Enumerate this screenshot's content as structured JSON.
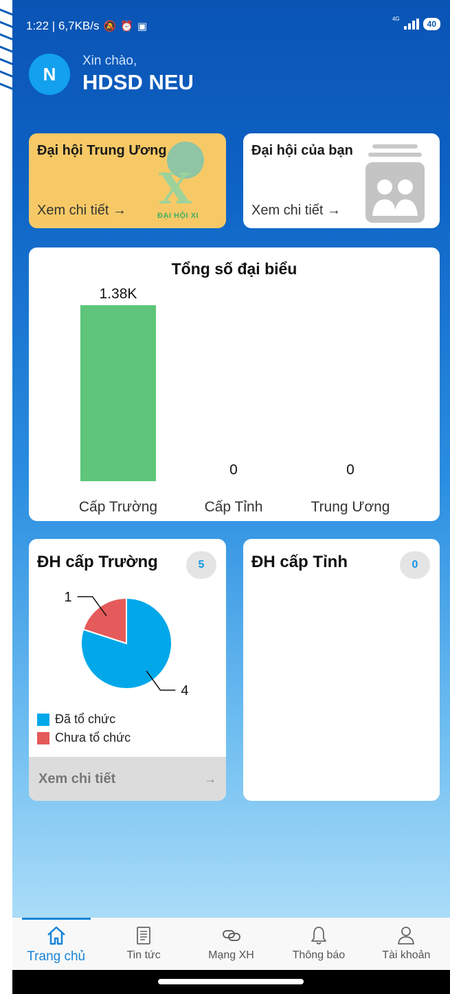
{
  "status_bar": {
    "time_speed": "1:22 | 6,7KB/s",
    "network": "4G",
    "battery": "40"
  },
  "greeting": {
    "avatar_initial": "N",
    "hello": "Xin chào,",
    "name": "HDSD NEU"
  },
  "cards": {
    "central": {
      "title": "Đại hội Trung Ương",
      "link": "Xem chi tiết →",
      "logo_text": "ĐẠI HỘI XI"
    },
    "yours": {
      "title": "Đại hội của bạn",
      "link": "Xem chi tiết →"
    }
  },
  "total_delegates": {
    "title": "Tổng số đại biểu"
  },
  "chart_data": {
    "type": "bar",
    "title": "Tổng số đại biểu",
    "categories": [
      "Cấp Trường",
      "Cấp Tỉnh",
      "Trung Ương"
    ],
    "values": [
      1380,
      0,
      0
    ],
    "value_labels": [
      "1.38K",
      "0",
      "0"
    ],
    "bar_color": "#5ec57b"
  },
  "school_section": {
    "title": "ĐH cấp Trường",
    "count": "5",
    "pie": {
      "slices": [
        {
          "label": "Đã tổ chức",
          "value": 4,
          "color": "#00a8ea"
        },
        {
          "label": "Chưa tổ chức",
          "value": 1,
          "color": "#e55a5a"
        }
      ],
      "value_labels": [
        "4",
        "1"
      ]
    },
    "legend": [
      "Đã tổ chức",
      "Chưa tổ chức"
    ],
    "detail_label": "Xem chi tiết",
    "detail_arrow": "→"
  },
  "province_section": {
    "title": "ĐH cấp Tỉnh",
    "count": "0"
  },
  "bottom_nav": {
    "items": [
      {
        "label": "Trang chủ",
        "icon": "home-icon",
        "active": true
      },
      {
        "label": "Tin tức",
        "icon": "news-icon"
      },
      {
        "label": "Mạng XH",
        "icon": "link-icon"
      },
      {
        "label": "Thông báo",
        "icon": "bell-icon"
      },
      {
        "label": "Tài khoản",
        "icon": "user-icon"
      }
    ]
  },
  "colors": {
    "primary": "#0a54b4",
    "accent": "#1683d8",
    "card_central": "#f7c966"
  }
}
